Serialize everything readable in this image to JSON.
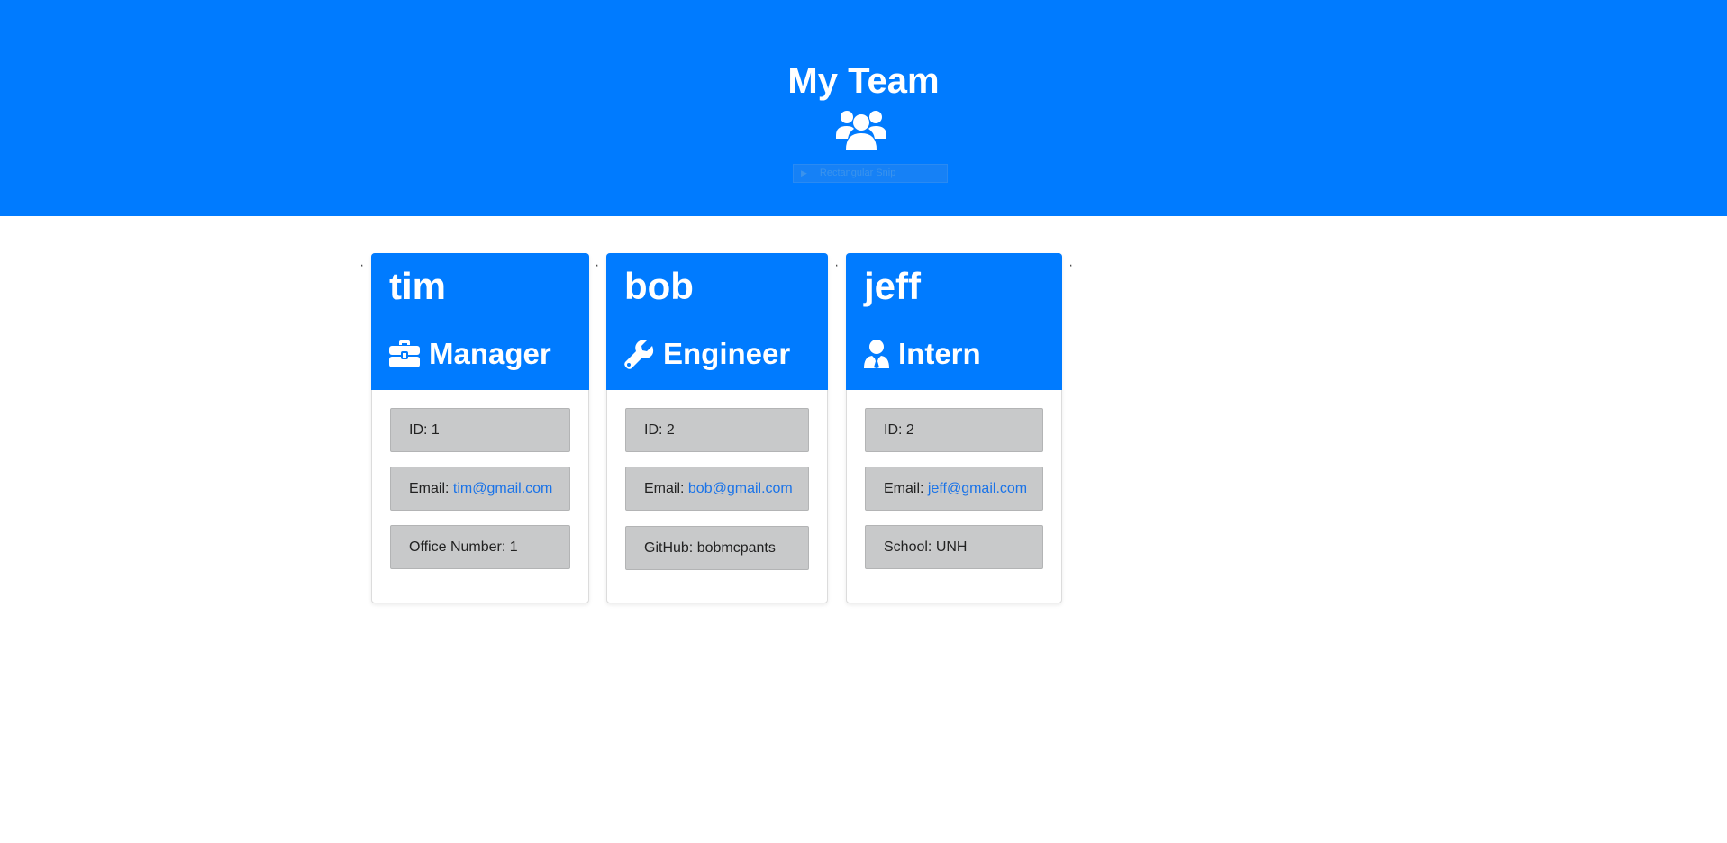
{
  "header": {
    "title": "My Team",
    "icon": "users-icon",
    "bg_color": "#007bff",
    "snip_overlay": "Rectangular Snip"
  },
  "employees": [
    {
      "name": "tim",
      "role": "Manager",
      "role_icon": "briefcase-icon",
      "id_label": "ID: 1",
      "email_label": "Email: ",
      "email": "tim@gmail.com",
      "extra_label": "Office Number: 1"
    },
    {
      "name": "bob",
      "role": "Engineer",
      "role_icon": "wrench-icon",
      "id_label": "ID: 2",
      "email_label": "Email: ",
      "email": "bob@gmail.com",
      "extra_label": "GitHub: bobmcpants"
    },
    {
      "name": "jeff",
      "role": "Intern",
      "role_icon": "user-tie-icon",
      "id_label": "ID: 2",
      "email_label": "Email: ",
      "email": "jeff@gmail.com",
      "extra_label": "School: UNH"
    }
  ],
  "separator_mark": ","
}
